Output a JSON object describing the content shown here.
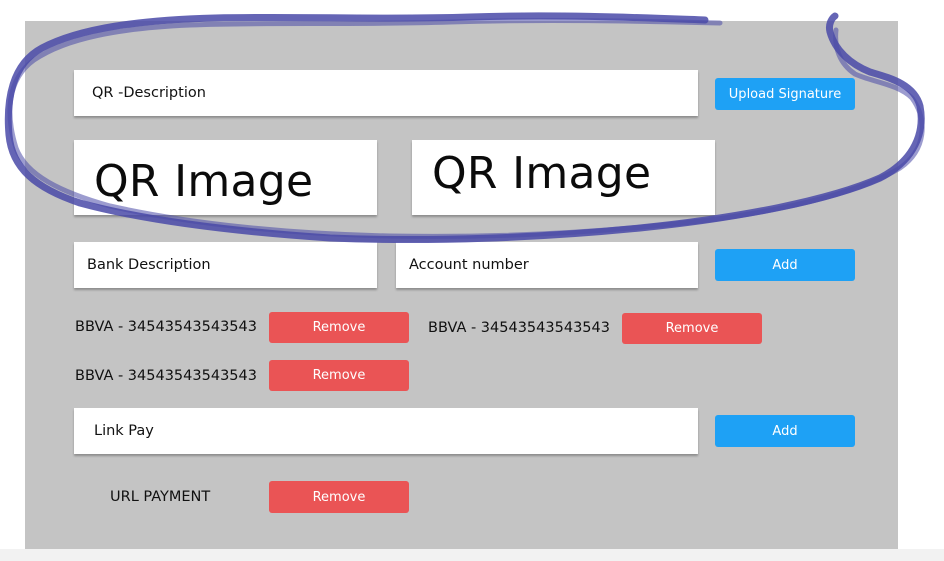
{
  "colors": {
    "panel_bg": "#c4c4c4",
    "primary_button": "#1ea1f5",
    "danger_button": "#ea5455",
    "annotation_stroke": "#4a4aa8"
  },
  "qr_section": {
    "description_placeholder": "QR -Description",
    "upload_signature_label": "Upload Signature",
    "qr_image_1": "QR Image",
    "qr_image_2": "QR Image"
  },
  "bank_section": {
    "bank_description_placeholder": "Bank Description",
    "account_number_placeholder": "Account number",
    "add_label": "Add",
    "entries": [
      {
        "text": "BBVA - 34543543543543",
        "remove_label": "Remove"
      },
      {
        "text": "BBVA - 34543543543543",
        "remove_label": "Remove"
      },
      {
        "text": "BBVA - 34543543543543",
        "remove_label": "Remove"
      }
    ]
  },
  "link_pay_section": {
    "link_pay_placeholder": "Link Pay",
    "add_label": "Add",
    "entries": [
      {
        "text": "URL PAYMENT",
        "remove_label": "Remove"
      }
    ]
  }
}
